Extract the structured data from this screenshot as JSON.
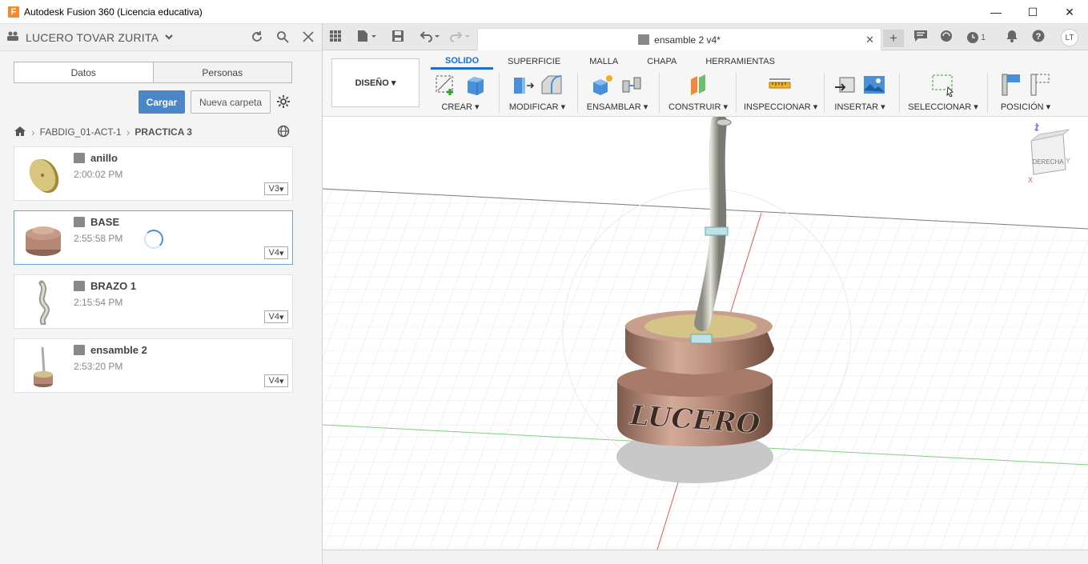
{
  "window": {
    "title": "Autodesk Fusion 360 (Licencia educativa)",
    "app_icon_letter": "F",
    "minimize": "—",
    "maximize": "☐",
    "close": "✕"
  },
  "data_panel": {
    "user": "LUCERO TOVAR ZURITA",
    "tabs": [
      "Datos",
      "Personas"
    ],
    "upload_label": "Cargar",
    "new_folder_label": "Nueva carpeta",
    "breadcrumb": [
      "FABDIG_01-ACT-1",
      "PRACTICA 3"
    ],
    "files": [
      {
        "name": "anillo",
        "time": "2:00:02 PM",
        "version": "V3"
      },
      {
        "name": "BASE",
        "time": "2:55:58 PM",
        "version": "V4"
      },
      {
        "name": "BRAZO 1",
        "time": "2:15:54 PM",
        "version": "V4"
      },
      {
        "name": "ensamble 2",
        "time": "2:53:20 PM",
        "version": "V4"
      }
    ]
  },
  "document": {
    "tab_title": "ensamble 2 v4*",
    "jobs_count": "1",
    "avatar_initials": "LT"
  },
  "toolbar": {
    "workspace": "DISEÑO",
    "tabs": [
      "SOLIDO",
      "SUPERFICIE",
      "MALLA",
      "CHAPA",
      "HERRAMIENTAS"
    ],
    "active_tab": "SOLIDO",
    "groups": [
      "CREAR",
      "MODIFICAR",
      "ENSAMBLAR",
      "CONSTRUIR",
      "INSPECCIONAR",
      "INSERTAR",
      "SELECCIONAR",
      "POSICIÓN"
    ]
  },
  "viewport": {
    "viewcube_face": "DERECHA",
    "viewcube_axis_z": "Z",
    "viewcube_axis_y": "Y",
    "viewcube_axis_x": "X",
    "model_text": "LUCERO"
  },
  "colors": {
    "accent": "#1a6fc9",
    "upload_button": "#4a86c8",
    "body_copper": "#b98c7a",
    "top_gold": "#cdbf80"
  }
}
